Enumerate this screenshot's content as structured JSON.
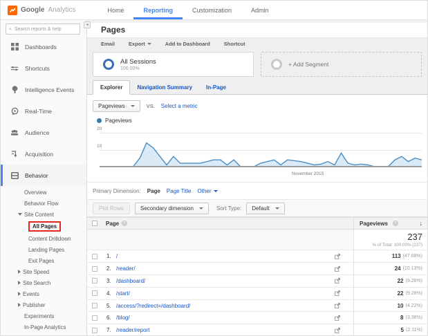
{
  "header": {
    "logo_google": "Google",
    "logo_analytics": "Analytics",
    "nav": [
      {
        "label": "Home",
        "active": false
      },
      {
        "label": "Reporting",
        "active": true
      },
      {
        "label": "Customization",
        "active": false
      },
      {
        "label": "Admin",
        "active": false
      }
    ]
  },
  "sidebar": {
    "search_placeholder": "Search reports & help",
    "items": [
      {
        "label": "Dashboards",
        "icon": "dashboards-icon"
      },
      {
        "label": "Shortcuts",
        "icon": "shortcuts-icon"
      },
      {
        "label": "Intelligence Events",
        "icon": "intelligence-icon"
      },
      {
        "label": "Real-Time",
        "icon": "realtime-icon"
      },
      {
        "label": "Audience",
        "icon": "audience-icon"
      },
      {
        "label": "Acquisition",
        "icon": "acquisition-icon"
      },
      {
        "label": "Behavior",
        "icon": "behavior-icon",
        "active": true
      }
    ],
    "subnav": [
      {
        "label": "Overview"
      },
      {
        "label": "Behavior Flow"
      },
      {
        "label": "Site Content",
        "state": "expanded"
      },
      {
        "label": "All Pages",
        "selected": true
      },
      {
        "label": "Content Drilldown"
      },
      {
        "label": "Landing Pages"
      },
      {
        "label": "Exit Pages"
      },
      {
        "label": "Site Speed",
        "state": "collapsed"
      },
      {
        "label": "Site Search",
        "state": "collapsed"
      },
      {
        "label": "Events",
        "state": "collapsed"
      },
      {
        "label": "Publisher",
        "state": "collapsed"
      },
      {
        "label": "Experiments"
      },
      {
        "label": "In-Page Analytics"
      }
    ]
  },
  "main": {
    "title": "Pages",
    "toolbar": {
      "email": "Email",
      "export": "Export",
      "add_to_dashboard": "Add to Dashboard",
      "shortcut": "Shortcut"
    },
    "segments": {
      "all_sessions": "All Sessions",
      "all_sessions_pct": "100.00%",
      "add_segment": "+ Add Segment"
    },
    "tabs": [
      {
        "label": "Explorer",
        "active": true
      },
      {
        "label": "Navigation Summary",
        "active": false
      },
      {
        "label": "In-Page",
        "active": false
      }
    ],
    "metric_picker": {
      "selected": "Pageviews",
      "vs": "VS.",
      "compare_link": "Select a metric"
    },
    "legend": "Pageviews",
    "primary_dimension": {
      "label": "Primary Dimension:",
      "selected": "Page",
      "option2": "Page Title",
      "option3": "Other"
    },
    "controls": {
      "plot_rows": "Plot Rows",
      "secondary_dimension": "Secondary dimension",
      "sort_type_label": "Sort Type:",
      "sort_type_value": "Default"
    },
    "table": {
      "col_page": "Page",
      "col_pageviews": "Pageviews",
      "total_value": "237",
      "total_note": "% of Total: 100.00% (237)",
      "rows": [
        {
          "index": "1.",
          "page": "/",
          "views": "113",
          "pct": "(47.68%)"
        },
        {
          "index": "2.",
          "page": "/reader/",
          "views": "24",
          "pct": "(10.13%)"
        },
        {
          "index": "3.",
          "page": "/dashboard/",
          "views": "22",
          "pct": "(9.28%)"
        },
        {
          "index": "4.",
          "page": "/start/",
          "views": "22",
          "pct": "(9.28%)"
        },
        {
          "index": "5.",
          "page": "/access/?redirect=/dashboard/",
          "views": "10",
          "pct": "(4.22%)"
        },
        {
          "index": "6.",
          "page": "/blog/",
          "views": "8",
          "pct": "(3.38%)"
        },
        {
          "index": "7.",
          "page": "/reader/report",
          "views": "5",
          "pct": "(2.11%)"
        }
      ]
    }
  },
  "icons": {
    "help": "?",
    "sort_desc": "↓",
    "collapse": "◂"
  },
  "colors": {
    "accent_blue": "#4285f4",
    "link_blue": "#1155cc",
    "chart_line": "#4d8fc4",
    "chart_fill": "#daeaf7",
    "highlight_red": "#e02a20",
    "logo_orange": "#ff6600"
  },
  "chart_data": {
    "type": "area",
    "series_name": "Pageviews",
    "xlabel": "November 2015",
    "ylim": [
      0,
      22
    ],
    "yticks": [
      10,
      20
    ],
    "grid": true,
    "values": [
      0,
      0,
      0,
      0,
      0,
      0,
      5,
      14,
      11,
      6,
      1,
      6,
      2,
      2,
      2,
      2,
      3,
      4,
      4,
      1,
      4,
      0,
      0,
      0,
      2,
      3,
      4,
      1,
      4,
      3.5,
      3,
      2,
      1,
      1.5,
      3,
      1,
      8,
      2,
      1,
      1.5,
      1,
      0,
      0,
      0,
      4,
      6,
      3,
      5,
      4
    ]
  }
}
